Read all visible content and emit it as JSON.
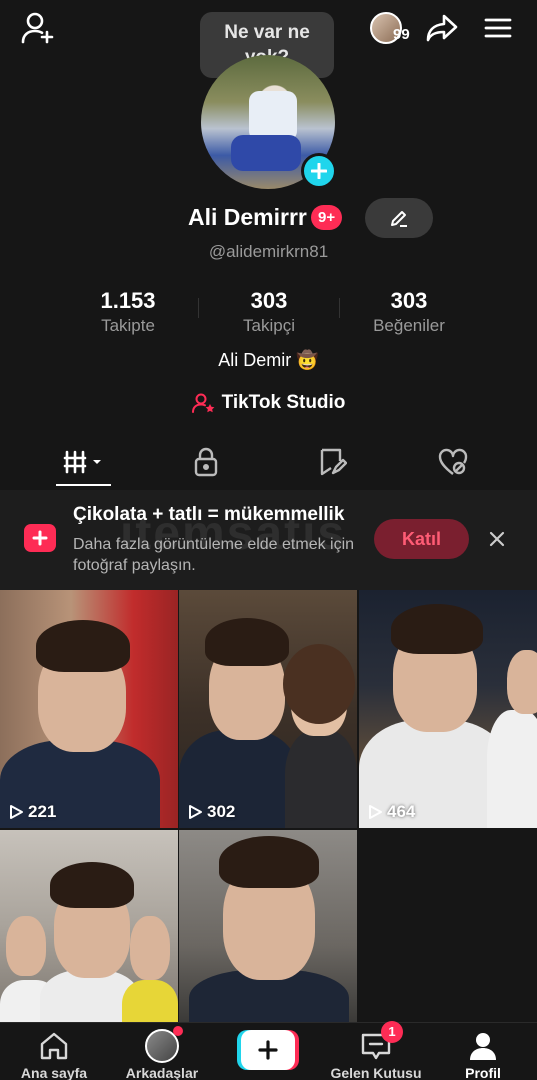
{
  "top_bar": {
    "note_bubble": "Ne var ne yok?",
    "story_count": "99"
  },
  "profile": {
    "display_name": "Ali Demirrr",
    "badge": "9+",
    "username": "@alidemirkrn81",
    "stats": [
      {
        "value": "1.153",
        "label": "Takipte"
      },
      {
        "value": "303",
        "label": "Takipçi"
      },
      {
        "value": "303",
        "label": "Beğeniler"
      }
    ],
    "bio": "Ali Demir 🤠",
    "studio_link": "TikTok Studio"
  },
  "tabs": [
    {
      "name": "videos-tab",
      "icon": "grid-icon",
      "active": true
    },
    {
      "name": "private-tab",
      "icon": "lock-icon",
      "active": false
    },
    {
      "name": "saved-tab",
      "icon": "bookmark-icon",
      "active": false
    },
    {
      "name": "liked-tab",
      "icon": "heart-icon",
      "active": false
    }
  ],
  "promo": {
    "title": "Çikolata + tatlı = mükemmellik",
    "description": "Daha fazla görüntüleme elde etmek için fotoğraf paylaşın.",
    "join_label": "Katıl",
    "watermark": "itemsatis"
  },
  "videos": [
    {
      "views": "221"
    },
    {
      "views": "302"
    },
    {
      "views": "464"
    },
    {
      "views": ""
    },
    {
      "views": ""
    }
  ],
  "bottom_nav": [
    {
      "label": "Ana sayfa",
      "icon": "home-icon"
    },
    {
      "label": "Arkadaşlar",
      "icon": "friends-avatar"
    },
    {
      "label": "",
      "icon": "plus-icon"
    },
    {
      "label": "Gelen Kutusu",
      "icon": "inbox-icon",
      "badge": "1"
    },
    {
      "label": "Profil",
      "icon": "profile-icon",
      "active": true
    }
  ],
  "colors": {
    "accent": "#fe2c55",
    "cyan": "#20d5ec",
    "background": "#161616"
  }
}
